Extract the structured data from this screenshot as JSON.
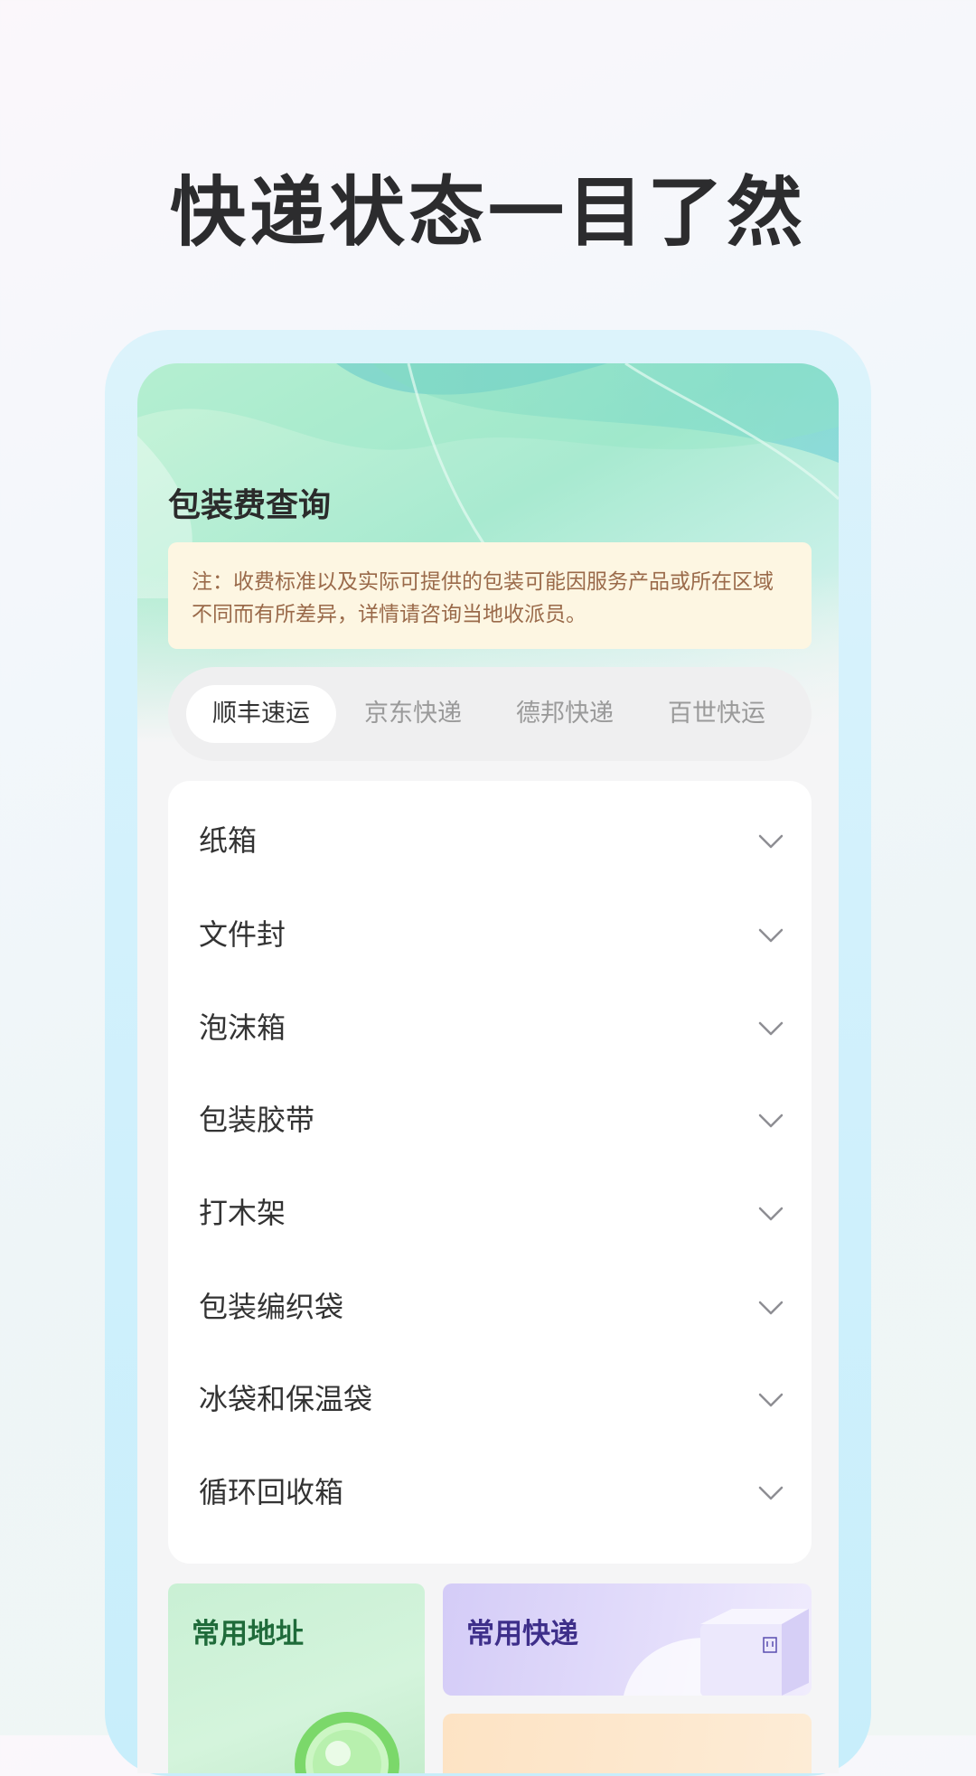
{
  "hero": {
    "title": "快递状态一目了然"
  },
  "page": {
    "title": "包装费查询",
    "notice": "注：收费标准以及实际可提供的包装可能因服务产品或所在区域不同而有所差异，详情请咨询当地收派员。"
  },
  "tabs": [
    {
      "label": "顺丰速运",
      "active": true
    },
    {
      "label": "京东快递",
      "active": false
    },
    {
      "label": "德邦快递",
      "active": false
    },
    {
      "label": "百世快运",
      "active": false
    }
  ],
  "packaging_items": [
    {
      "label": "纸箱",
      "icon": "chevron-down-icon"
    },
    {
      "label": "文件封",
      "icon": "chevron-down-icon"
    },
    {
      "label": "泡沫箱",
      "icon": "chevron-down-icon"
    },
    {
      "label": "包装胶带",
      "icon": "chevron-down-icon"
    },
    {
      "label": "打木架",
      "icon": "chevron-down-icon"
    },
    {
      "label": "包装编织袋",
      "icon": "chevron-down-icon"
    },
    {
      "label": "冰袋和保温袋",
      "icon": "chevron-down-icon"
    },
    {
      "label": "循环回收箱",
      "icon": "chevron-down-icon"
    }
  ],
  "tiles": {
    "address": {
      "title": "常用地址",
      "icon": "location-ring-icon"
    },
    "express": {
      "title": "常用快递",
      "icon": "parcel-box-icon"
    }
  },
  "colors": {
    "notice_bg": "#fdf6e2",
    "notice_text": "#9a6a4a",
    "address_tile": "#c9f0d4",
    "express_tile": "#d4ccf7",
    "orange_tile": "#fde3c4"
  }
}
